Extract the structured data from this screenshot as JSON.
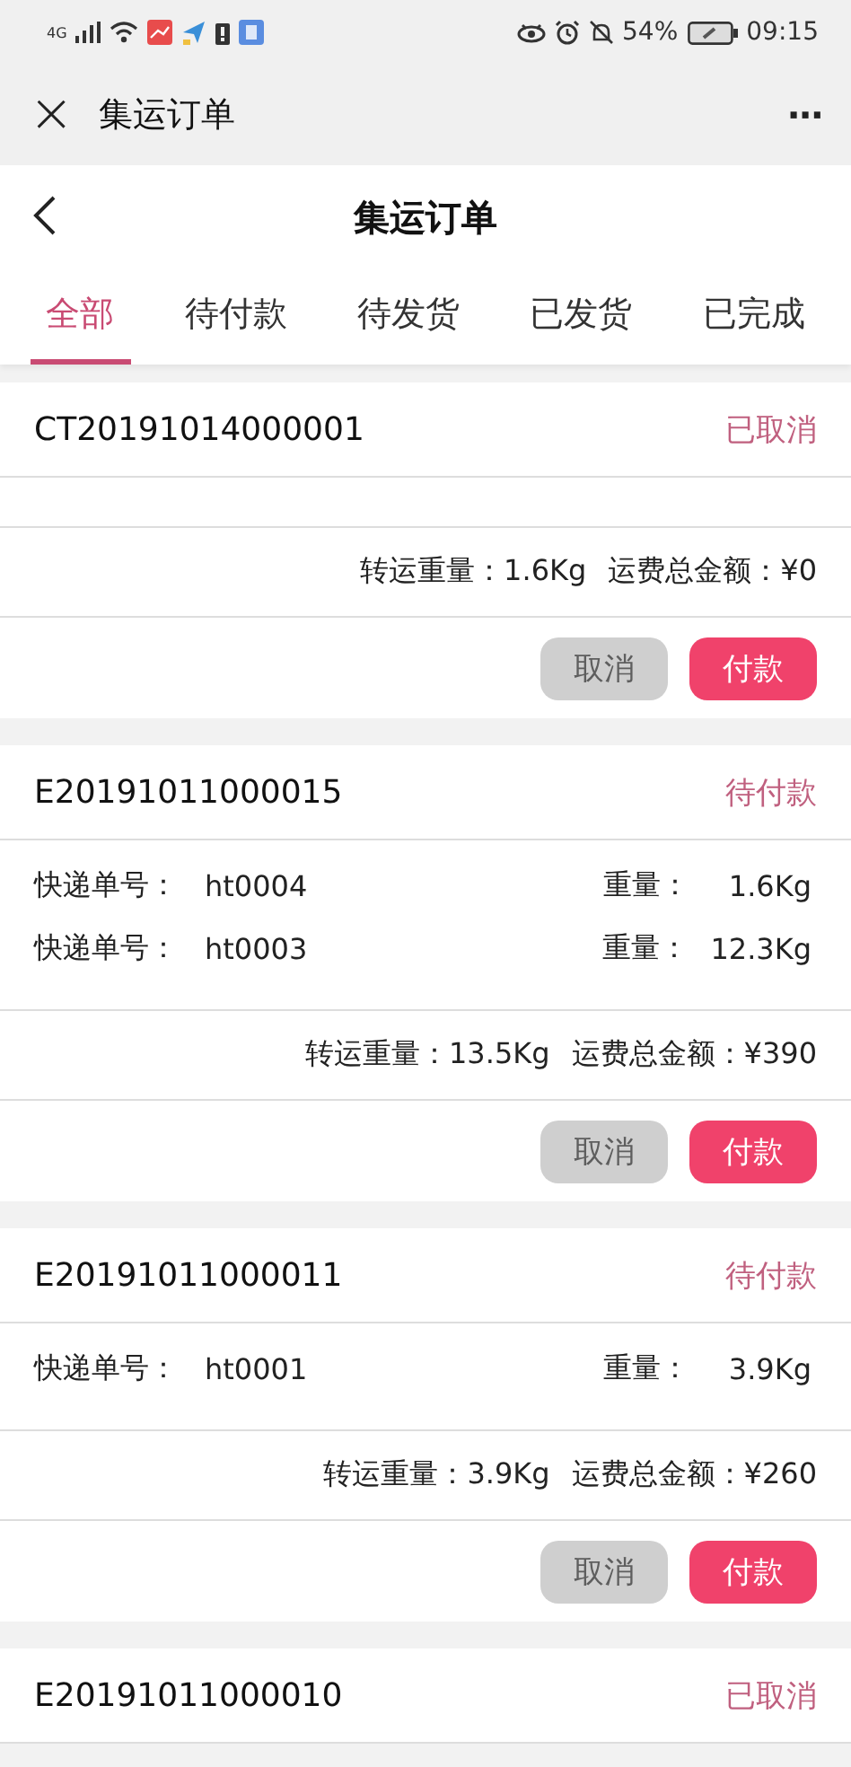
{
  "status_bar": {
    "network": "4G",
    "battery_percent": "54%",
    "time": "09:15"
  },
  "webview_bar": {
    "close": "×",
    "title": "集运订单",
    "more": "···"
  },
  "header": {
    "title": "集运订单"
  },
  "tabs": [
    {
      "label": "全部",
      "selected": true
    },
    {
      "label": "待付款",
      "selected": false
    },
    {
      "label": "待发货",
      "selected": false
    },
    {
      "label": "已发货",
      "selected": false
    },
    {
      "label": "已完成",
      "selected": false
    }
  ],
  "orders": [
    {
      "order_no": "CT20191014000001",
      "status": "已取消",
      "total_weight": "转运重量：1.6Kg",
      "total_amount": "运费总金额：¥0",
      "buttons": [
        {
          "label": "取消",
          "kind": "cancel",
          "disabled": true
        },
        {
          "label": "付款",
          "kind": "pay",
          "disabled": false
        }
      ]
    },
    {
      "order_no": "E20191011000015",
      "status": "待付款",
      "items": [
        {
          "tracking_label": "快递单号：",
          "tracking_no": "ht0004",
          "weight_label": "重量：",
          "weight": "1.6Kg"
        },
        {
          "tracking_label": "快递单号：",
          "tracking_no": "ht0003",
          "weight_label": "重量：",
          "weight": "12.3Kg"
        }
      ],
      "total_weight": "转运重量：13.5Kg",
      "total_amount": "运费总金额：¥390",
      "buttons": [
        {
          "label": "取消",
          "kind": "cancel",
          "disabled": true
        },
        {
          "label": "付款",
          "kind": "pay",
          "disabled": false
        }
      ]
    },
    {
      "order_no": "E20191011000011",
      "status": "待付款",
      "items": [
        {
          "tracking_label": "快递单号：",
          "tracking_no": "ht0001",
          "weight_label": "重量：",
          "weight": "3.9Kg"
        }
      ],
      "total_weight": "转运重量：3.9Kg",
      "total_amount": "运费总金额：¥260",
      "buttons": [
        {
          "label": "取消",
          "kind": "cancel",
          "disabled": true
        },
        {
          "label": "付款",
          "kind": "pay",
          "disabled": false
        }
      ]
    },
    {
      "order_no": "E20191011000010",
      "status": "已取消"
    }
  ]
}
